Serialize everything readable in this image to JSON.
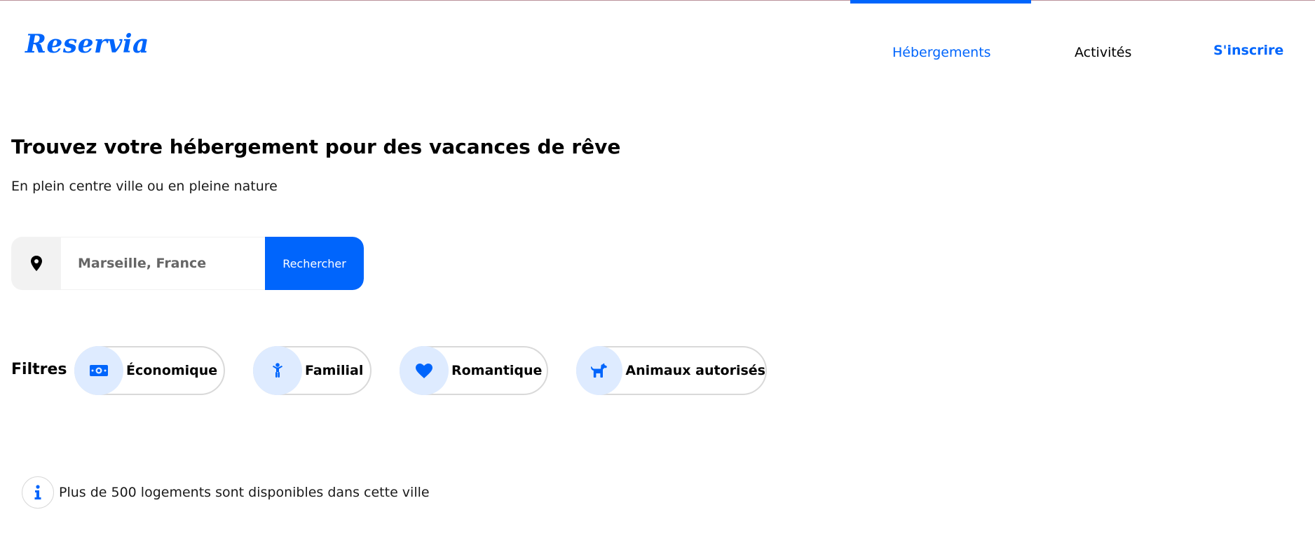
{
  "brand": {
    "logo_text": "Reservia",
    "accent_color": "#0065FC"
  },
  "nav": {
    "items": [
      {
        "label": "Hébergements",
        "active": true
      },
      {
        "label": "Activités",
        "active": false
      }
    ],
    "signup_label": "S'inscrire"
  },
  "hero": {
    "title": "Trouvez votre hébergement pour des vacances de rêve",
    "subtitle": "En plein centre ville ou en pleine nature"
  },
  "search": {
    "icon": "location-pin-icon",
    "placeholder": "Marseille, France",
    "value": "",
    "button_label": "Rechercher"
  },
  "filters": {
    "label": "Filtres",
    "items": [
      {
        "label": "Économique",
        "icon": "money-icon"
      },
      {
        "label": "Familial",
        "icon": "child-icon"
      },
      {
        "label": "Romantique",
        "icon": "heart-icon"
      },
      {
        "label": "Animaux autorisés",
        "icon": "dog-icon"
      }
    ]
  },
  "info": {
    "icon": "info-icon",
    "text": "Plus de 500 logements sont disponibles dans cette ville"
  }
}
